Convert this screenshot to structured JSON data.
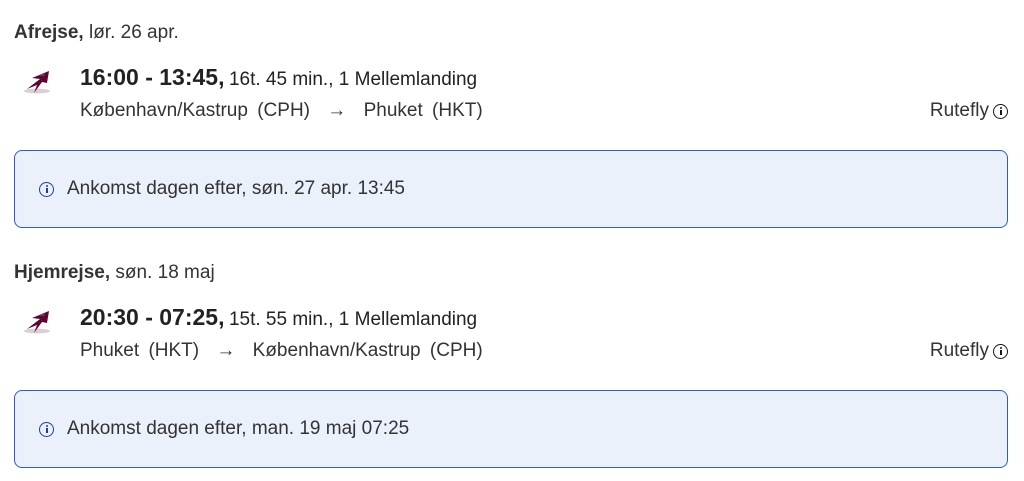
{
  "outbound": {
    "label": "Afrejse,",
    "date": "lør. 26 apr.",
    "airline_icon": "qatar-airways-logo-icon",
    "times": "16:00 - 13:45,",
    "duration_stops": "16t. 45 min., 1 Mellemlanding",
    "origin_city": "København/Kastrup",
    "origin_code": "(CPH)",
    "arrow": "→",
    "destination_city": "Phuket",
    "destination_code": "(HKT)",
    "flight_type": "Rutefly",
    "notice": "Ankomst dagen efter, søn. 27 apr. 13:45"
  },
  "return": {
    "label": "Hjemrejse,",
    "date": "søn. 18 maj",
    "airline_icon": "qatar-airways-logo-icon",
    "times": "20:30 - 07:25,",
    "duration_stops": "15t. 55 min., 1 Mellemlanding",
    "origin_city": "Phuket",
    "origin_code": "(HKT)",
    "arrow": "→",
    "destination_city": "København/Kastrup",
    "destination_code": "(CPH)",
    "flight_type": "Rutefly",
    "notice": "Ankomst dagen efter, man. 19 maj 07:25"
  },
  "colors": {
    "notice_background": "#eaf1fb",
    "notice_border": "#2f5bd1",
    "info_icon": "#1d3ea8",
    "airline_brand": "#5c0632"
  }
}
